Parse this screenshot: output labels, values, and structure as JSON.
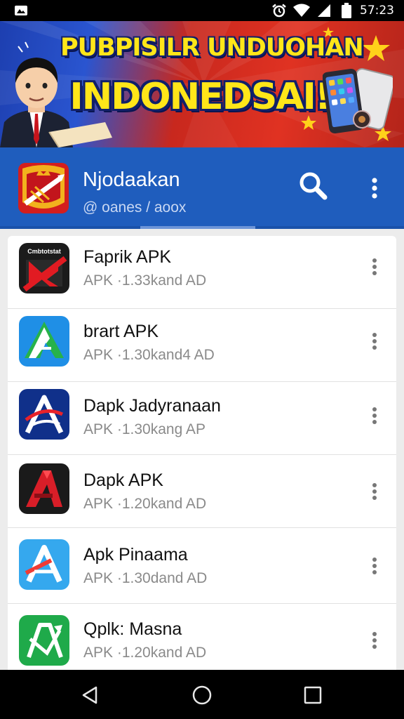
{
  "status_bar": {
    "time": "57:23",
    "icons": [
      "notification-image-icon",
      "alarm-icon",
      "wifi-icon",
      "signal-icon",
      "battery-icon"
    ]
  },
  "banner": {
    "line1": "PUBPISILR UNDUOHAN",
    "line2": "INDONEDSAI!"
  },
  "header": {
    "title": "Njodaakan",
    "subtitle": "@ oanes / aoox",
    "accent_color": "#1f5dbd"
  },
  "apps": [
    {
      "name": "Faprik APK",
      "meta": "APK ·1.33kand AD",
      "icon": "faprik-app-icon",
      "logo_text": "Cmbtotstat"
    },
    {
      "name": "brart APK",
      "meta": "APK ·1.30kand4 AD",
      "icon": "brart-app-icon"
    },
    {
      "name": "Dapk Jadyranaan",
      "meta": "APK ·1.30kang AP",
      "icon": "dapk-jadyranaan-app-icon"
    },
    {
      "name": "Dapk APK",
      "meta": "APK ·1.20kand AD",
      "icon": "dapk-app-icon"
    },
    {
      "name": "Apk Pinaama",
      "meta": "APK ·1.30dand AD",
      "icon": "apk-pinaama-app-icon"
    },
    {
      "name": "Qplk: Masna",
      "meta": "APK ·1.20kand AD",
      "icon": "qplk-masna-app-icon"
    }
  ],
  "nav": {
    "icons": [
      "back-icon",
      "home-icon",
      "recents-icon"
    ]
  }
}
